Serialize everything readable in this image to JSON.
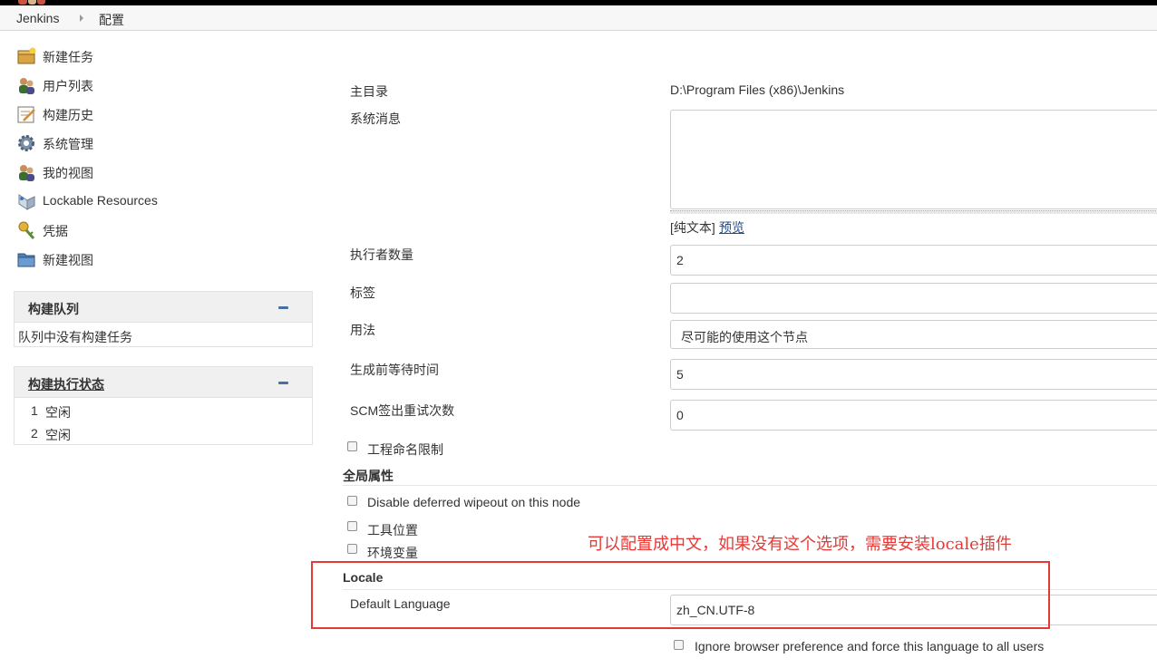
{
  "breadcrumb": {
    "home": "Jenkins",
    "current": "配置"
  },
  "sidebar": {
    "tasks": [
      {
        "label": "新建任务",
        "icon": "new-item-icon"
      },
      {
        "label": "用户列表",
        "icon": "users-icon"
      },
      {
        "label": "构建历史",
        "icon": "build-history-icon"
      },
      {
        "label": "系统管理",
        "icon": "gear-icon"
      },
      {
        "label": "我的视图",
        "icon": "my-views-icon"
      },
      {
        "label": "Lockable Resources",
        "icon": "lockable-resources-icon"
      },
      {
        "label": "凭据",
        "icon": "credentials-icon"
      },
      {
        "label": "新建视图",
        "icon": "folder-icon"
      }
    ],
    "build_queue": {
      "title": "构建队列",
      "empty_text": "队列中没有构建任务"
    },
    "executor_status": {
      "title": "构建执行状态",
      "executors": [
        {
          "number": "1",
          "status": "空闲"
        },
        {
          "number": "2",
          "status": "空闲"
        }
      ]
    }
  },
  "config": {
    "home_dir": {
      "label": "主目录",
      "value": "D:\\Program Files (x86)\\Jenkins"
    },
    "system_message": {
      "label": "系统消息",
      "value": "",
      "format_text": "[纯文本]",
      "preview_link": "预览"
    },
    "executors_count": {
      "label": "执行者数量",
      "value": "2"
    },
    "labels": {
      "label": "标签",
      "value": ""
    },
    "usage": {
      "label": "用法",
      "value": "尽可能的使用这个节点"
    },
    "quiet_period": {
      "label": "生成前等待时间",
      "value": "5"
    },
    "scm_retry": {
      "label": "SCM签出重试次数",
      "value": "0"
    },
    "project_naming": {
      "label": "工程命名限制",
      "checked": false
    },
    "global_props": {
      "title": "全局属性",
      "disable_wipeout": {
        "label": "Disable deferred wipeout on this node",
        "checked": false
      },
      "tool_locations": {
        "label": "工具位置",
        "checked": false
      },
      "env_vars": {
        "label": "环境变量",
        "checked": false
      }
    },
    "locale": {
      "title": "Locale",
      "default_language": {
        "label": "Default Language",
        "value": "zh_CN.UTF-8"
      },
      "ignore_browser": {
        "label": "Ignore browser preference and force this language to all users",
        "checked": false
      }
    }
  },
  "annotation": {
    "text": "可以配置成中文，如果没有这个选项，需要安装locale插件",
    "color": "#e53935"
  },
  "colors": {
    "link": "#204a87",
    "pane_header": "#f0f0f0",
    "annotation": "#e53935"
  }
}
